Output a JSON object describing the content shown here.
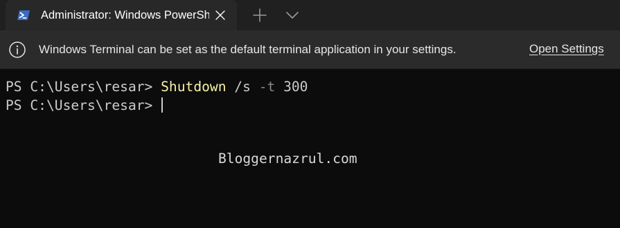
{
  "tab": {
    "title": "Administrator: Windows PowerShell",
    "icon": "powershell-icon"
  },
  "titlebar_buttons": {
    "close_icon": "close-icon",
    "new_tab_icon": "plus-icon",
    "dropdown_icon": "chevron-down-icon"
  },
  "infobar": {
    "icon": "info-icon",
    "message": "Windows Terminal can be set as the default terminal application in your settings.",
    "link_label": "Open Settings"
  },
  "terminal": {
    "lines": [
      {
        "prompt": "PS C:\\Users\\resar> ",
        "command": "Shutdown",
        "arg1": " /s ",
        "arg2": "-t",
        "arg3": " 300"
      },
      {
        "prompt": "PS C:\\Users\\resar> "
      }
    ]
  },
  "watermark": "Bloggernazrul.com",
  "colors": {
    "titlebar": "#202020",
    "active_tab": "#282828",
    "infobar": "#2b2b2b",
    "terminal_bg": "#0c0c0c",
    "terminal_text": "#cccccc",
    "command_text": "#f9f1a5",
    "powershell_icon": "#3b6cc2"
  }
}
